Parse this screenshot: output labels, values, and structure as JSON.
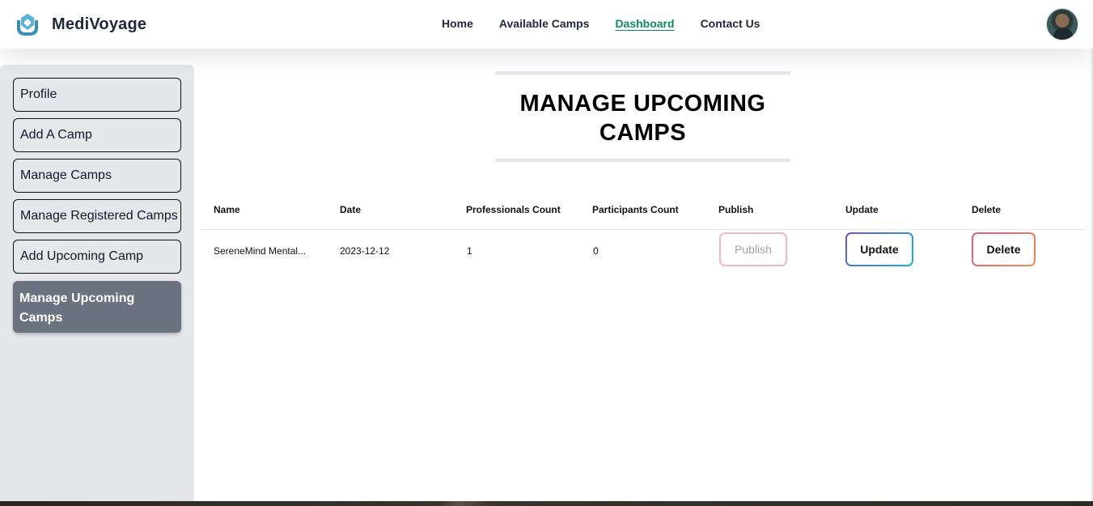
{
  "brand": {
    "name": "MediVoyage"
  },
  "nav": {
    "links": [
      {
        "label": "Home"
      },
      {
        "label": "Available Camps"
      },
      {
        "label": "Dashboard",
        "active": true
      },
      {
        "label": "Contact Us"
      }
    ]
  },
  "sidebar": {
    "items": [
      {
        "label": "Profile"
      },
      {
        "label": "Add A Camp"
      },
      {
        "label": "Manage Camps"
      },
      {
        "label": "Manage Registered Camps"
      },
      {
        "label": "Add Upcoming Camp"
      },
      {
        "label": "Manage Upcoming Camps",
        "active": true
      }
    ]
  },
  "page": {
    "title": "MANAGE UPCOMING CAMPS"
  },
  "table": {
    "headers": [
      "Name",
      "Date",
      "Professionals Count",
      "Participants Count",
      "Publish",
      "Update",
      "Delete"
    ],
    "rows": [
      {
        "name": "SereneMind Mental...",
        "date": "2023-12-12",
        "professionals": "1",
        "participants": "0",
        "publish_label": "Publish",
        "update_label": "Update",
        "delete_label": "Delete"
      }
    ]
  },
  "colors": {
    "active_nav": "#0f8a5f",
    "sidebar_bg": "#e5e7eb",
    "sidebar_active": "#6b7280"
  }
}
